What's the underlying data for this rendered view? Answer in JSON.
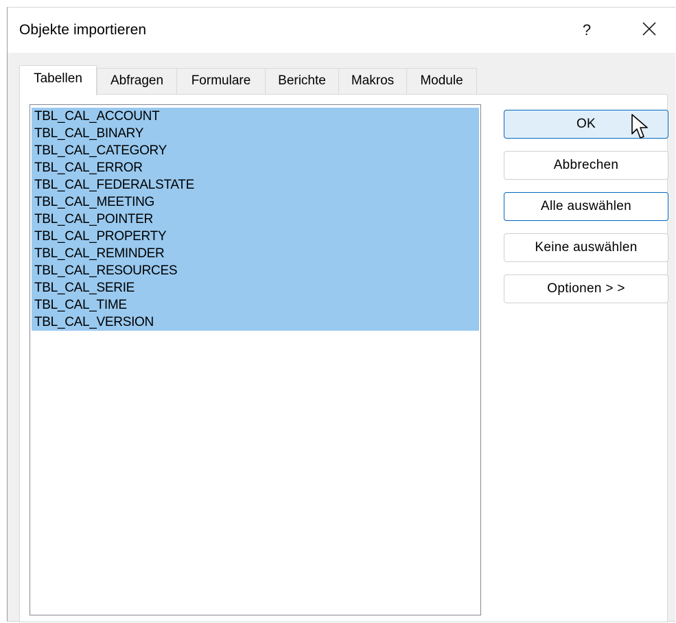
{
  "window": {
    "title": "Objekte importieren",
    "help_label": "?"
  },
  "tabs": [
    {
      "label": "Tabellen",
      "active": true
    },
    {
      "label": "Abfragen",
      "active": false
    },
    {
      "label": "Formulare",
      "active": false
    },
    {
      "label": "Berichte",
      "active": false
    },
    {
      "label": "Makros",
      "active": false
    },
    {
      "label": "Module",
      "active": false
    }
  ],
  "list": {
    "items": [
      "TBL_CAL_ACCOUNT",
      "TBL_CAL_BINARY",
      "TBL_CAL_CATEGORY",
      "TBL_CAL_ERROR",
      "TBL_CAL_FEDERALSTATE",
      "TBL_CAL_MEETING",
      "TBL_CAL_POINTER",
      "TBL_CAL_PROPERTY",
      "TBL_CAL_REMINDER",
      "TBL_CAL_RESOURCES",
      "TBL_CAL_SERIE",
      "TBL_CAL_TIME",
      "TBL_CAL_VERSION"
    ],
    "selection_color": "#99c9ef"
  },
  "buttons": {
    "ok": "OK",
    "cancel": "Abbrechen",
    "select_all": "Alle auswählen",
    "select_none": "Keine auswählen",
    "options": "Optionen > >"
  },
  "colors": {
    "accent": "#0067c0",
    "dialog_bg": "#f0f0f0",
    "default_button_bg": "#e0eef9"
  }
}
